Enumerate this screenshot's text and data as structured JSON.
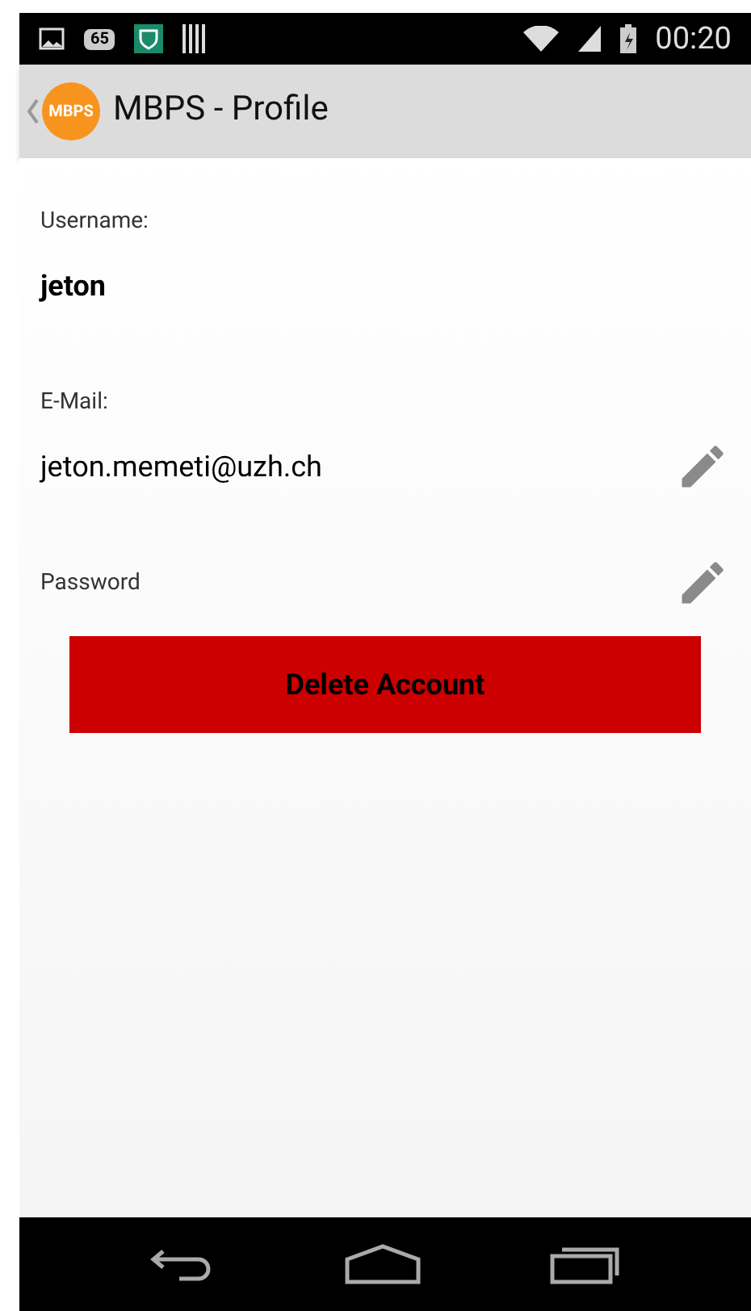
{
  "status_bar": {
    "notification_badge": "65",
    "time": "00:20"
  },
  "action_bar": {
    "logo_text": "MBPS",
    "title": "MBPS - Profile"
  },
  "fields": [
    {
      "label": "Username:",
      "value": "jeton",
      "bold": true,
      "editable": false
    },
    {
      "label": "E-Mail:",
      "value": "jeton.memeti@uzh.ch",
      "bold": false,
      "editable": true
    },
    {
      "label": "Password",
      "editable": true
    }
  ],
  "delete_button": "Delete Account"
}
